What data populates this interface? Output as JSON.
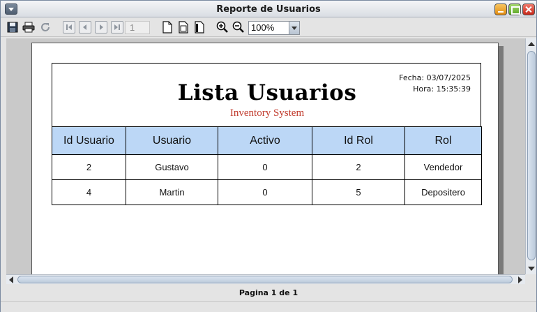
{
  "window": {
    "title": "Reporte de Usuarios"
  },
  "toolbar": {
    "icons": [
      "save-icon",
      "print-icon",
      "refresh-icon",
      "first-page-icon",
      "previous-page-icon",
      "next-page-icon",
      "last-page-icon",
      "actual-size-icon",
      "fit-page-icon",
      "fit-width-icon",
      "zoom-in-icon",
      "zoom-out-icon"
    ],
    "page_number": "1",
    "zoom": "100%"
  },
  "report": {
    "fecha": "Fecha: 03/07/2025",
    "hora": "Hora: 15:35:39",
    "title": "Lista Usuarios",
    "subtitle": "Inventory System",
    "columns": [
      "Id Usuario",
      "Usuario",
      "Activo",
      "Id Rol",
      "Rol"
    ],
    "rows": [
      [
        "2",
        "Gustavo",
        "0",
        "2",
        "Vendedor"
      ],
      [
        "4",
        "Martin",
        "0",
        "5",
        "Depositero"
      ]
    ]
  },
  "status": {
    "page_label": "Pagina 1 de 1"
  },
  "colors": {
    "header_fill": "#bcd7f6",
    "subtitle": "#c0392b"
  }
}
